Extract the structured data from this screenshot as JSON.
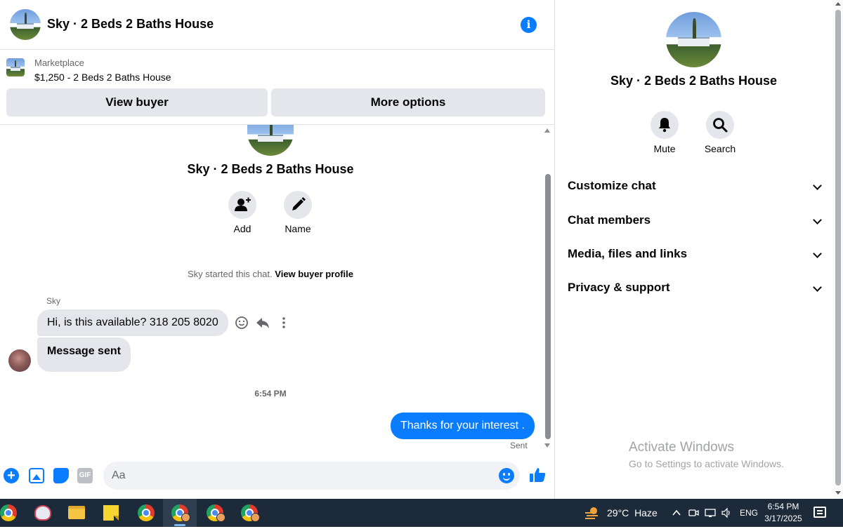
{
  "header": {
    "title": "Sky · 2 Beds 2 Baths House",
    "info_icon": "info-icon"
  },
  "listing": {
    "label": "Marketplace",
    "price_title": "$1,250 - 2 Beds 2 Baths House",
    "view_buyer_label": "View buyer",
    "more_options_label": "More options"
  },
  "thread": {
    "title": "Sky · 2 Beds 2 Baths House",
    "actions": [
      {
        "label": "Add",
        "icon": "add-person-icon"
      },
      {
        "label": "Name",
        "icon": "pencil-icon"
      }
    ],
    "started_text": "Sky started this chat.",
    "view_profile_link": "View buyer profile",
    "sender_name": "Sky",
    "incoming_messages": [
      "Hi, is this available? 318 205 8020",
      "Message sent"
    ],
    "timestamp": "6:54 PM",
    "outgoing_message": "Thanks for your interest .",
    "outgoing_status": "Sent"
  },
  "composer": {
    "placeholder": "Aa",
    "gif_label": "GIF",
    "plus_label": "+",
    "accent_color": "#0a7cff"
  },
  "details": {
    "title": "Sky · 2 Beds 2 Baths House",
    "mute_label": "Mute",
    "search_label": "Search",
    "sections": [
      "Customize chat",
      "Chat members",
      "Media, files and links",
      "Privacy & support"
    ]
  },
  "watermark": {
    "line1": "Activate Windows",
    "line2": "Go to Settings to activate Windows."
  },
  "taskbar": {
    "weather_temp": "29°C",
    "weather_desc": "Haze",
    "language": "ENG",
    "time": "6:54 PM",
    "date": "3/17/2025",
    "apps": [
      "chrome-icon",
      "petal-icon",
      "file-explorer-icon",
      "sticky-notes-icon",
      "chrome-icon",
      "chrome-profile-icon",
      "chrome-profile-icon",
      "chrome-profile-icon"
    ]
  }
}
